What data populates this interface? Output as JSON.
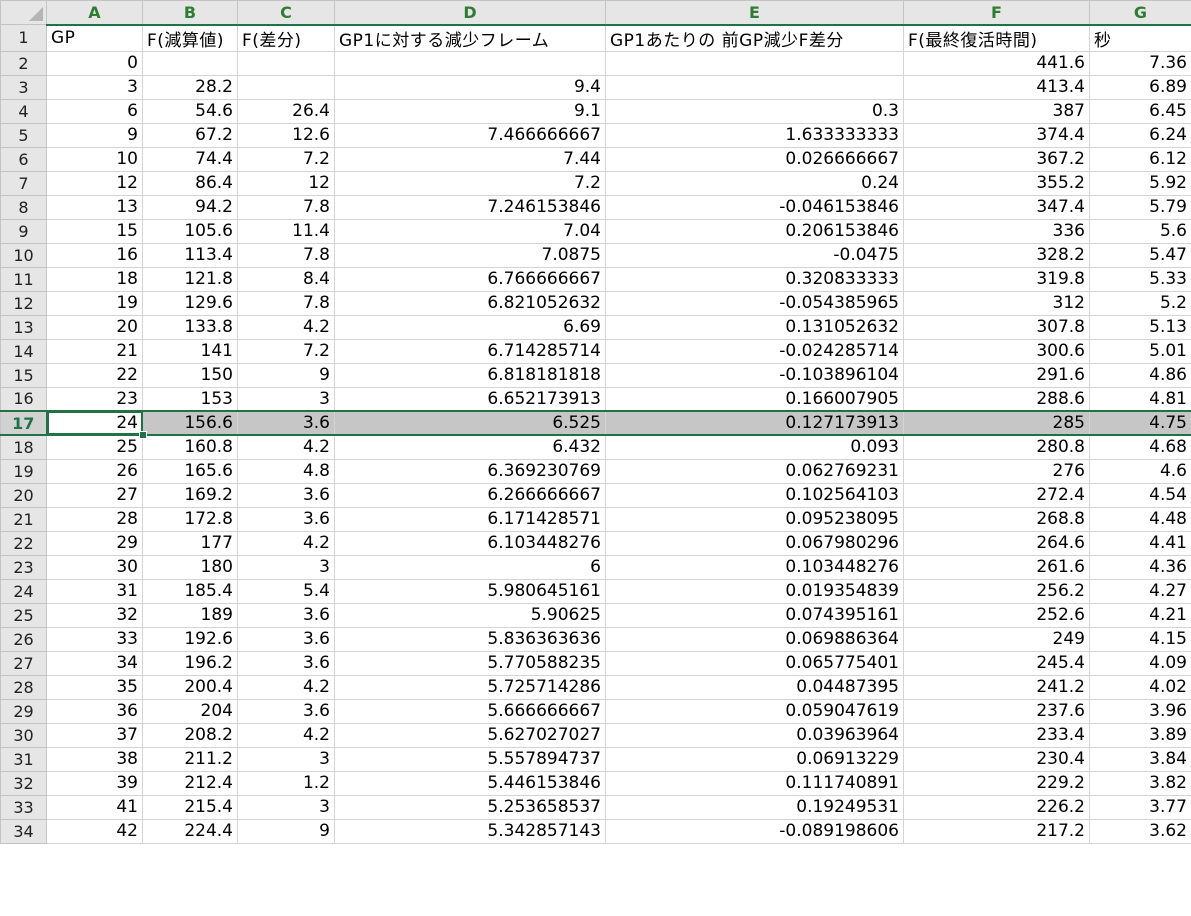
{
  "columns": [
    "A",
    "B",
    "C",
    "D",
    "E",
    "F",
    "G"
  ],
  "header_row": {
    "row": "1",
    "cells": [
      "GP",
      "F(減算値)",
      "F(差分)",
      "GP1に対する減少フレーム",
      "GP1あたりの 前GP減少F差分",
      "F(最終復活時間)",
      "秒"
    ]
  },
  "rows": [
    {
      "row": "2",
      "cells": [
        "0",
        "",
        "",
        "",
        "",
        "441.6",
        "7.36"
      ]
    },
    {
      "row": "3",
      "cells": [
        "3",
        "28.2",
        "",
        "9.4",
        "",
        "413.4",
        "6.89"
      ]
    },
    {
      "row": "4",
      "cells": [
        "6",
        "54.6",
        "26.4",
        "9.1",
        "0.3",
        "387",
        "6.45"
      ]
    },
    {
      "row": "5",
      "cells": [
        "9",
        "67.2",
        "12.6",
        "7.466666667",
        "1.633333333",
        "374.4",
        "6.24"
      ]
    },
    {
      "row": "6",
      "cells": [
        "10",
        "74.4",
        "7.2",
        "7.44",
        "0.026666667",
        "367.2",
        "6.12"
      ]
    },
    {
      "row": "7",
      "cells": [
        "12",
        "86.4",
        "12",
        "7.2",
        "0.24",
        "355.2",
        "5.92"
      ]
    },
    {
      "row": "8",
      "cells": [
        "13",
        "94.2",
        "7.8",
        "7.246153846",
        "-0.046153846",
        "347.4",
        "5.79"
      ]
    },
    {
      "row": "9",
      "cells": [
        "15",
        "105.6",
        "11.4",
        "7.04",
        "0.206153846",
        "336",
        "5.6"
      ]
    },
    {
      "row": "10",
      "cells": [
        "16",
        "113.4",
        "7.8",
        "7.0875",
        "-0.0475",
        "328.2",
        "5.47"
      ]
    },
    {
      "row": "11",
      "cells": [
        "18",
        "121.8",
        "8.4",
        "6.766666667",
        "0.320833333",
        "319.8",
        "5.33"
      ]
    },
    {
      "row": "12",
      "cells": [
        "19",
        "129.6",
        "7.8",
        "6.821052632",
        "-0.054385965",
        "312",
        "5.2"
      ]
    },
    {
      "row": "13",
      "cells": [
        "20",
        "133.8",
        "4.2",
        "6.69",
        "0.131052632",
        "307.8",
        "5.13"
      ]
    },
    {
      "row": "14",
      "cells": [
        "21",
        "141",
        "7.2",
        "6.714285714",
        "-0.024285714",
        "300.6",
        "5.01"
      ]
    },
    {
      "row": "15",
      "cells": [
        "22",
        "150",
        "9",
        "6.818181818",
        "-0.103896104",
        "291.6",
        "4.86"
      ]
    },
    {
      "row": "16",
      "cells": [
        "23",
        "153",
        "3",
        "6.652173913",
        "0.166007905",
        "288.6",
        "4.81"
      ]
    },
    {
      "row": "17",
      "cells": [
        "24",
        "156.6",
        "3.6",
        "6.525",
        "0.127173913",
        "285",
        "4.75"
      ]
    },
    {
      "row": "18",
      "cells": [
        "25",
        "160.8",
        "4.2",
        "6.432",
        "0.093",
        "280.8",
        "4.68"
      ]
    },
    {
      "row": "19",
      "cells": [
        "26",
        "165.6",
        "4.8",
        "6.369230769",
        "0.062769231",
        "276",
        "4.6"
      ]
    },
    {
      "row": "20",
      "cells": [
        "27",
        "169.2",
        "3.6",
        "6.266666667",
        "0.102564103",
        "272.4",
        "4.54"
      ]
    },
    {
      "row": "21",
      "cells": [
        "28",
        "172.8",
        "3.6",
        "6.171428571",
        "0.095238095",
        "268.8",
        "4.48"
      ]
    },
    {
      "row": "22",
      "cells": [
        "29",
        "177",
        "4.2",
        "6.103448276",
        "0.067980296",
        "264.6",
        "4.41"
      ]
    },
    {
      "row": "23",
      "cells": [
        "30",
        "180",
        "3",
        "6",
        "0.103448276",
        "261.6",
        "4.36"
      ]
    },
    {
      "row": "24",
      "cells": [
        "31",
        "185.4",
        "5.4",
        "5.980645161",
        "0.019354839",
        "256.2",
        "4.27"
      ]
    },
    {
      "row": "25",
      "cells": [
        "32",
        "189",
        "3.6",
        "5.90625",
        "0.074395161",
        "252.6",
        "4.21"
      ]
    },
    {
      "row": "26",
      "cells": [
        "33",
        "192.6",
        "3.6",
        "5.836363636",
        "0.069886364",
        "249",
        "4.15"
      ]
    },
    {
      "row": "27",
      "cells": [
        "34",
        "196.2",
        "3.6",
        "5.770588235",
        "0.065775401",
        "245.4",
        "4.09"
      ]
    },
    {
      "row": "28",
      "cells": [
        "35",
        "200.4",
        "4.2",
        "5.725714286",
        "0.04487395",
        "241.2",
        "4.02"
      ]
    },
    {
      "row": "29",
      "cells": [
        "36",
        "204",
        "3.6",
        "5.666666667",
        "0.059047619",
        "237.6",
        "3.96"
      ]
    },
    {
      "row": "30",
      "cells": [
        "37",
        "208.2",
        "4.2",
        "5.627027027",
        "0.03963964",
        "233.4",
        "3.89"
      ]
    },
    {
      "row": "31",
      "cells": [
        "38",
        "211.2",
        "3",
        "5.557894737",
        "0.06913229",
        "230.4",
        "3.84"
      ]
    },
    {
      "row": "32",
      "cells": [
        "39",
        "212.4",
        "1.2",
        "5.446153846",
        "0.111740891",
        "229.2",
        "3.82"
      ]
    },
    {
      "row": "33",
      "cells": [
        "41",
        "215.4",
        "3",
        "5.253658537",
        "0.19249531",
        "226.2",
        "3.77"
      ]
    },
    {
      "row": "34",
      "cells": [
        "42",
        "224.4",
        "9",
        "5.342857143",
        "-0.089198606",
        "217.2",
        "3.62"
      ]
    }
  ],
  "selection": {
    "row": "17",
    "active_column": "A"
  },
  "accent_color": "#217346"
}
